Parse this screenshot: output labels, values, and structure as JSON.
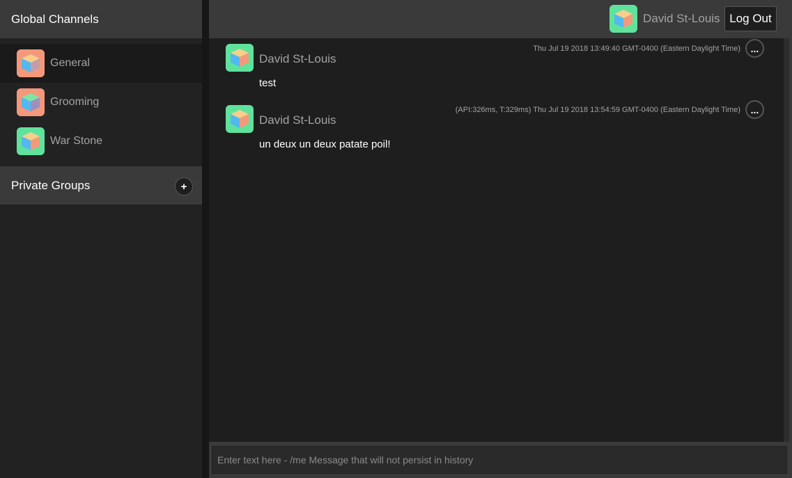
{
  "sidebar": {
    "global_title": "Global Channels",
    "channels": [
      {
        "label": "General",
        "avatar_bg": "#f4987c",
        "active": true
      },
      {
        "label": "Grooming",
        "avatar_bg": "#f4987c",
        "active": false
      },
      {
        "label": "War Stone",
        "avatar_bg": "#5fe39c",
        "active": false
      }
    ],
    "private_title": "Private Groups",
    "add_group_label": "+"
  },
  "header": {
    "user_name": "David St-Louis",
    "logout_label": "Log Out",
    "user_avatar_bg": "#5fe39c"
  },
  "messages": [
    {
      "author": "David St-Louis",
      "meta": "Thu Jul 19 2018 13:49:40 GMT-0400 (Eastern Daylight Time)",
      "text": "test",
      "more_label": "...",
      "avatar_bg": "#5fe39c"
    },
    {
      "author": "David St-Louis",
      "meta": "(API:326ms, T:329ms) Thu Jul 19 2018 13:54:59 GMT-0400 (Eastern Daylight Time)",
      "text": "un deux un deux patate poil!",
      "more_label": "...",
      "avatar_bg": "#5fe39c"
    }
  ],
  "composer": {
    "placeholder": "Enter text here - /me Message that will not persist in history",
    "value": ""
  },
  "colors": {
    "bg": "#1e1e1e",
    "panel": "#3a3a3a",
    "muted_text": "#a3a3a3",
    "cube_top": "#f7cf8b",
    "cube_left": "#53b8f0",
    "cube_right": "#f49a7a"
  }
}
